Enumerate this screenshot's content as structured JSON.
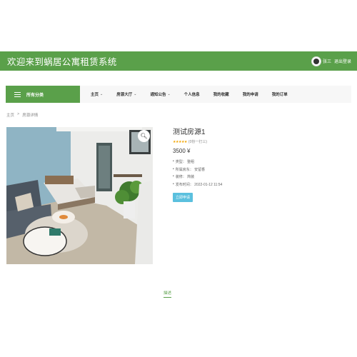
{
  "header": {
    "title": "欢迎来到蜗居公寓租赁系统",
    "user_name": "张三",
    "logout": "退出登录"
  },
  "nav": {
    "category": "所有分类",
    "items": [
      {
        "label": "主页",
        "has_caret": true
      },
      {
        "label": "房源大厅",
        "has_caret": true
      },
      {
        "label": "通知公告",
        "has_caret": true
      },
      {
        "label": "个人信息",
        "has_caret": false
      },
      {
        "label": "我的收藏",
        "has_caret": false
      },
      {
        "label": "我的申请",
        "has_caret": false
      },
      {
        "label": "我的订单",
        "has_caret": false
      }
    ]
  },
  "breadcrumb": {
    "home": "主页",
    "separator": ">",
    "current": "房源详情"
  },
  "room": {
    "title": "测试房源1",
    "stars": "★★★★★",
    "rating_text": "(0份一打三)",
    "price": "3500 ¥",
    "specs": {
      "type": "类型：  整租",
      "owner": "所属房东：  安留香",
      "decoration": "装修：  简装",
      "publish_time": "发布时间：  2022-01-12 11:54"
    },
    "apply_button": "立即申请"
  },
  "tabs": {
    "description": "描述"
  },
  "colors": {
    "brand_green": "#5aa04a",
    "button_blue": "#5bc0de",
    "star_orange": "#f2a400"
  }
}
